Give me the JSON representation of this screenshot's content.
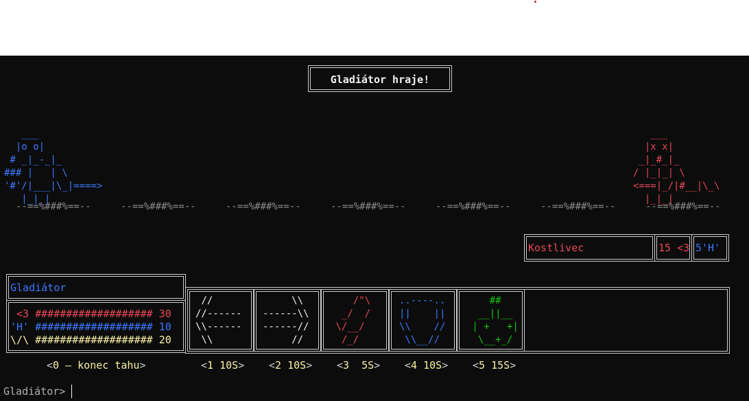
{
  "banner": "Gladiátor hraje!",
  "player_sprite": "   ___\n  |o o|\n # _|_-_|_\n### |   | \\\n'#'/|___|\\_|====>\n   |_|_|",
  "enemy_sprite": "   ___\n  |x x|\n _|_#_|_\n/ |_|_| \\\n<===|_/|#__|\\_\\\n  |_|_|",
  "floor_segment": "--==%###%==--",
  "enemy": {
    "name": "Kostlivec",
    "hp": "15 <3",
    "shield": "5'H'"
  },
  "player": {
    "name": "Gladiátor",
    "stats": [
      {
        "icon": " <3",
        "bar": "###################",
        "value": "30",
        "color": "#e74856"
      },
      {
        "icon": "'H'",
        "bar": "###################",
        "value": "10",
        "color": "#3b78ff"
      },
      {
        "icon": "\\/\\",
        "bar": "###################",
        "value": "20",
        "color": "#f9f1a5"
      }
    ]
  },
  "cards": [
    {
      "art": " //\n//------\n\\\\------\n \\\\",
      "color": "#f2f2f2"
    },
    {
      "art": "     \\\\\n------\\\\\n------//\n     //",
      "color": "#f2f2f2"
    },
    {
      "art": "    /\"\\\n  _/  /\n \\/__/\n  /_/",
      "color": "#e74856"
    },
    {
      "art": "..----..\n||    ||\n\\\\    //\n \\\\__//",
      "color": "#3b78ff"
    },
    {
      "art": "    ##\n  __||__\n | +   +|\n  \\__+_/",
      "color": "#16c60c"
    }
  ],
  "actions": [
    {
      "key": "0",
      "label": "0 – konec tahu"
    },
    {
      "key": "1",
      "label": "1 10S"
    },
    {
      "key": "2",
      "label": "2 10S"
    },
    {
      "key": "3",
      "label": "3  5S"
    },
    {
      "key": "4",
      "label": "4 10S"
    },
    {
      "key": "5",
      "label": "5 15S"
    }
  ],
  "prompt": "Gladiátor>"
}
